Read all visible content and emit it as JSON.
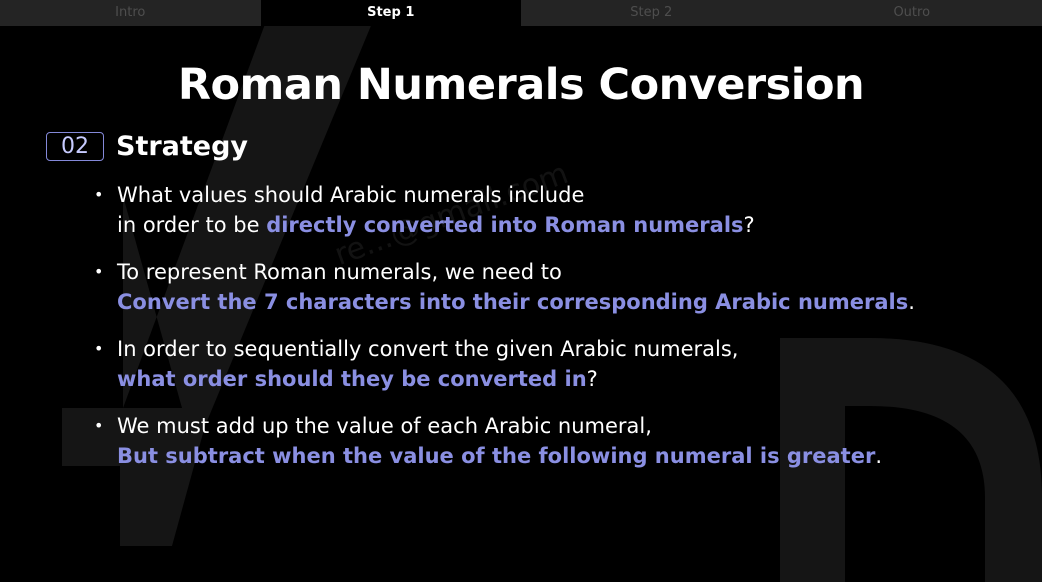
{
  "tabs": [
    {
      "label": "Intro",
      "active": false
    },
    {
      "label": "Step 1",
      "active": true
    },
    {
      "label": "Step 2",
      "active": false
    },
    {
      "label": "Outro",
      "active": false
    }
  ],
  "slide": {
    "title": "Roman Numerals Conversion",
    "section_number": "02",
    "section_title": "Strategy",
    "watermark": "re...@gmail.com",
    "bullets": [
      {
        "line1": "What values should Arabic numerals include",
        "line2_prefix": "in order to be ",
        "line2_highlight": "directly converted into Roman numerals",
        "line2_suffix": "?"
      },
      {
        "line1": "To represent Roman numerals, we need to",
        "line2_prefix": "",
        "line2_highlight": "Convert the 7 characters into their corresponding Arabic numerals",
        "line2_suffix": "."
      },
      {
        "line1": "In order to sequentially convert the given Arabic numerals,",
        "line2_prefix": "",
        "line2_highlight": "what order should they be converted in",
        "line2_suffix": "?"
      },
      {
        "line1": "We must add up the value of each Arabic numeral,",
        "line2_prefix": "",
        "line2_highlight": "But subtract when the value of the following numeral is greater",
        "line2_suffix": "."
      }
    ]
  },
  "colors": {
    "background": "#000000",
    "highlight": "#8a8fe2",
    "tab_bar": "#242424",
    "section_border": "#8489d9"
  }
}
